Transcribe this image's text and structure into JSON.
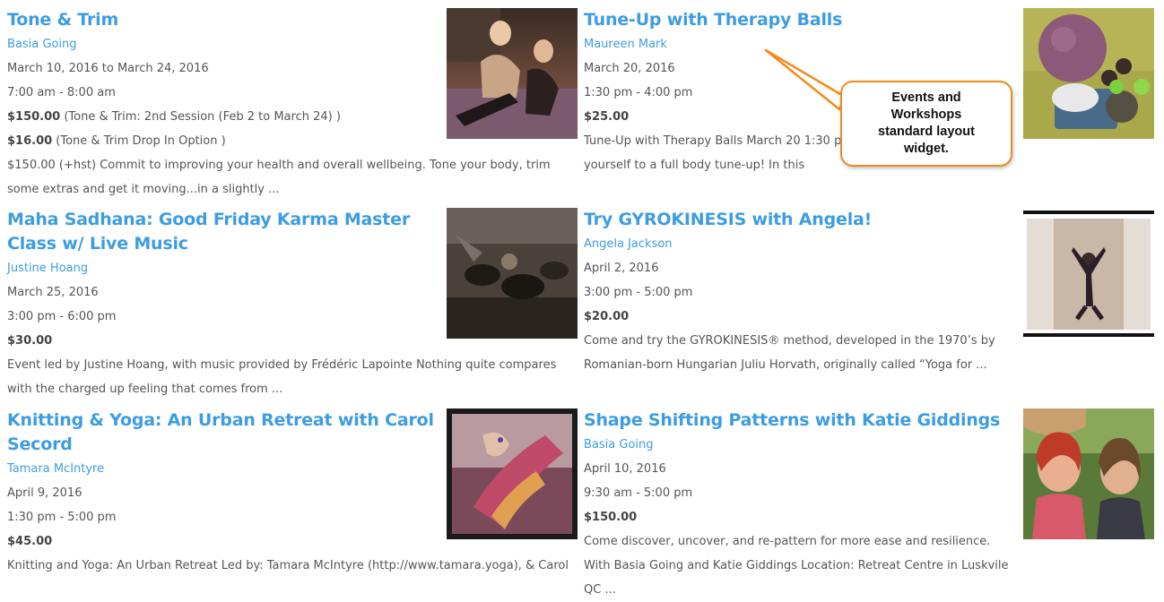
{
  "events": [
    {
      "title": "Tone & Trim",
      "organizer": "Basia Going",
      "date": "March 10, 2016 to March 24, 2016",
      "time": "7:00 am - 8:00 am",
      "prices": [
        {
          "amount": "$150.00",
          "note": " (Tone & Trim: 2nd Session (Feb 2 to March 24) )"
        },
        {
          "amount": "$16.00",
          "note": " (Tone & Trim Drop In Option )"
        }
      ],
      "description": "$150.00 (+hst) Commit to improving your health and overall wellbeing. Tone your body, trim some extras and get it moving...in a slightly  ..."
    },
    {
      "title": "Tune-Up with Therapy Balls",
      "organizer": "Maureen Mark",
      "date": "March 20, 2016",
      "time": "1:30 pm - 4:00 pm",
      "prices": [
        {
          "amount": "$25.00",
          "note": ""
        }
      ],
      "description": "Tune-Up with Therapy Balls March 20 1:30 pm yourself to a full body tune-up! In this workshop"
    },
    {
      "title": "Maha Sadhana: Good Friday Karma Master Class w/ Live Music",
      "organizer": "Justine Hoang",
      "date": "March 25, 2016",
      "time": "3:00 pm - 6:00 pm",
      "prices": [
        {
          "amount": "$30.00",
          "note": ""
        }
      ],
      "description": "Event led by Justine Hoang, with music provided by Frédéric Lapointe Nothing quite compares with the charged up feeling that comes from ..."
    },
    {
      "title": "Try GYROKINESIS with Angela!",
      "organizer": "Angela Jackson",
      "date": "April 2, 2016",
      "time": "3:00 pm - 5:00 pm",
      "prices": [
        {
          "amount": "$20.00",
          "note": ""
        }
      ],
      "description": "Come and try the GYROKINESIS® method, developed in the 1970’s by Romanian-born Hungarian Juliu Horvath, originally called “Yoga for  ..."
    },
    {
      "title": "Knitting & Yoga: An Urban Retreat with Carol Secord",
      "organizer": "Tamara McIntyre",
      "date": "April 9, 2016",
      "time": "1:30 pm - 5:00 pm",
      "prices": [
        {
          "amount": "$45.00",
          "note": ""
        }
      ],
      "description": "Knitting and Yoga: An Urban Retreat Led by: Tamara McIntyre (http://www.tamara.yoga), & Carol"
    },
    {
      "title": "Shape Shifting Patterns with Katie Giddings",
      "organizer": "Basia Going",
      "date": "April 10, 2016",
      "time": "9:30 am - 5:00 pm",
      "prices": [
        {
          "amount": "$150.00",
          "note": ""
        }
      ],
      "description": "Come discover, uncover, and re-pattern for more ease and resilience. With Basia Going and Katie Giddings Location: Retreat Centre in Luskvile QC  ..."
    }
  ],
  "callout": {
    "text": "Events and Workshops standard layout widget."
  },
  "colors": {
    "link": "#3d9de0",
    "text": "#555555",
    "callout_border": "#f28a1e"
  }
}
